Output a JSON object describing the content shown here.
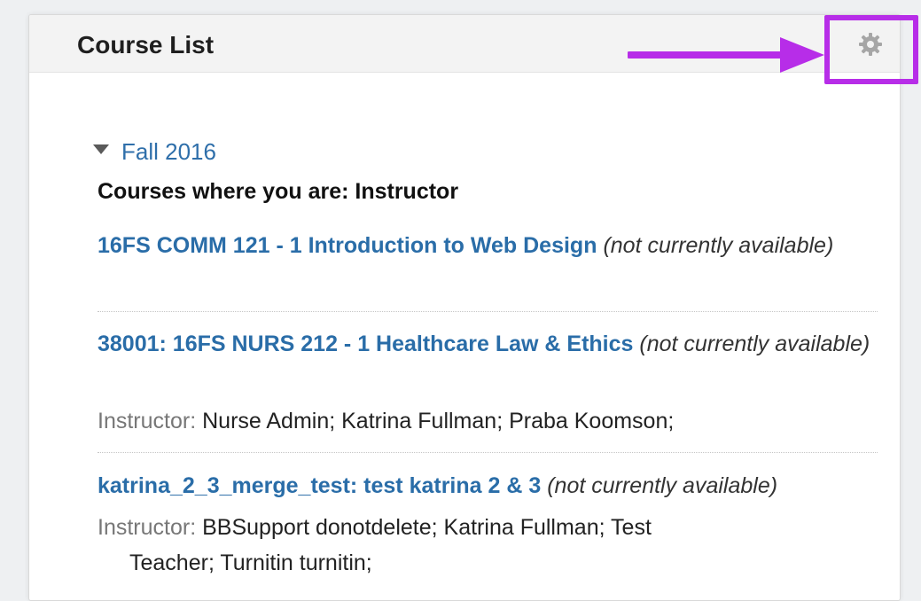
{
  "panel": {
    "title": "Course List"
  },
  "term": {
    "label": "Fall 2016"
  },
  "role_heading": "Courses where you are: Instructor",
  "courses": [
    {
      "link": "16FS COMM 121 - 1 Introduction to Web Design",
      "status": "(not currently available)",
      "instructors": null
    },
    {
      "link": "38001: 16FS NURS 212 - 1 Healthcare Law & Ethics",
      "status": "(not currently available)",
      "instructor_label": "Instructor:",
      "instructors": "Nurse Admin;  Katrina Fullman;  Praba Koomson;"
    },
    {
      "link": "katrina_2_3_merge_test: test katrina 2 & 3",
      "status": "(not currently available)",
      "instructor_label": "Instructor:",
      "instructors_line1": "BBSupport donotdelete;  Katrina Fullman;  Test",
      "instructors_line2": "Teacher;  Turnitin turnitin;"
    }
  ],
  "icons": {
    "gear": "gear-icon",
    "caret": "caret-down-icon",
    "arrow": "arrow-right-icon"
  },
  "colors": {
    "link": "#2a6da8",
    "highlight": "#b72de8",
    "gear": "#a6a6a6"
  }
}
